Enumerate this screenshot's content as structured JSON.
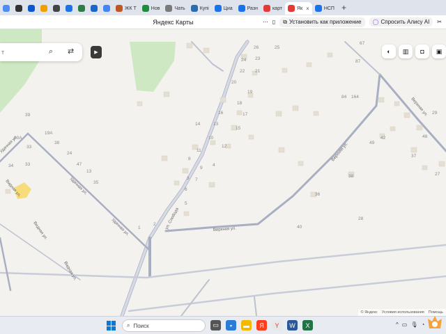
{
  "tabs": [
    {
      "label": "",
      "color": "#4c8df6"
    },
    {
      "label": "",
      "color": "#333333"
    },
    {
      "label": "",
      "color": "#0b57d0"
    },
    {
      "label": "",
      "color": "#f0a000"
    },
    {
      "label": "",
      "color": "#444444"
    },
    {
      "label": "",
      "color": "#1a73e8"
    },
    {
      "label": "",
      "color": "#2d7d46"
    },
    {
      "label": "",
      "color": "#1b66c9"
    },
    {
      "label": "",
      "color": "#4285f4"
    },
    {
      "label": "ЖК Т",
      "color": "#c05621"
    },
    {
      "label": "Нов",
      "color": "#1e8e3e"
    },
    {
      "label": "Чать",
      "color": "#7a7a7a"
    },
    {
      "label": "Купі",
      "color": "#2b6cb0"
    },
    {
      "label": "Циа",
      "color": "#1a73e8"
    },
    {
      "label": "Разн",
      "color": "#1a73e8"
    },
    {
      "label": "карт",
      "color": "#e53935"
    },
    {
      "label": "Як",
      "color": "#e53935",
      "active": true
    },
    {
      "label": "НСП",
      "color": "#1a73e8"
    }
  ],
  "address": {
    "url": "",
    "title": "Яндекс Карты",
    "install_app": "Установить как приложение",
    "ask_alice": "Спросить Алису AI"
  },
  "search": {
    "value": "т"
  },
  "map": {
    "streets": [
      {
        "name": "ул. Слобода",
        "id": "sloboda"
      },
      {
        "name": "Верхняя ул.",
        "id": "verkhnyaya-mid"
      },
      {
        "name": "Верхняя ул.",
        "id": "verkhnyaya-right"
      },
      {
        "name": "Верхняя ул.",
        "id": "verkhnyaya-far"
      },
      {
        "name": "Удачная ул.",
        "id": "udachnaya-1"
      },
      {
        "name": "Удачная ул.",
        "id": "udachnaya-2"
      },
      {
        "name": "Удачная ул.",
        "id": "udachnaya-3"
      },
      {
        "name": "Видная ул.",
        "id": "vidnaya-1"
      },
      {
        "name": "Видная ул.",
        "id": "vidnaya-2"
      },
      {
        "name": "Видная ул.",
        "id": "vidnaya-3"
      }
    ],
    "house_numbers": [
      "26",
      "25",
      "24",
      "23",
      "22",
      "21",
      "20",
      "19",
      "18",
      "17",
      "16",
      "15",
      "14",
      "13",
      "12",
      "11",
      "10",
      "9",
      "8",
      "7",
      "6",
      "5",
      "4",
      "3",
      "2",
      "1",
      "67",
      "87",
      "84",
      "164",
      "49",
      "48",
      "42",
      "29",
      "38",
      "36",
      "40",
      "28",
      "27",
      "37",
      "39",
      "19А",
      "33",
      "20А",
      "38",
      "24",
      "47",
      "13",
      "35",
      "34",
      "33"
    ]
  },
  "copyright": {
    "text": "© Яндекс",
    "terms": "Условия использования",
    "help": "Помощь"
  },
  "taskbar": {
    "search_placeholder": "Поиск"
  },
  "colors": {
    "road": "#c8ccd8",
    "road_edge": "#a9afc2",
    "green": "#cfe8c4",
    "building": "#e4ded4",
    "accent": "#fc3f1d"
  }
}
